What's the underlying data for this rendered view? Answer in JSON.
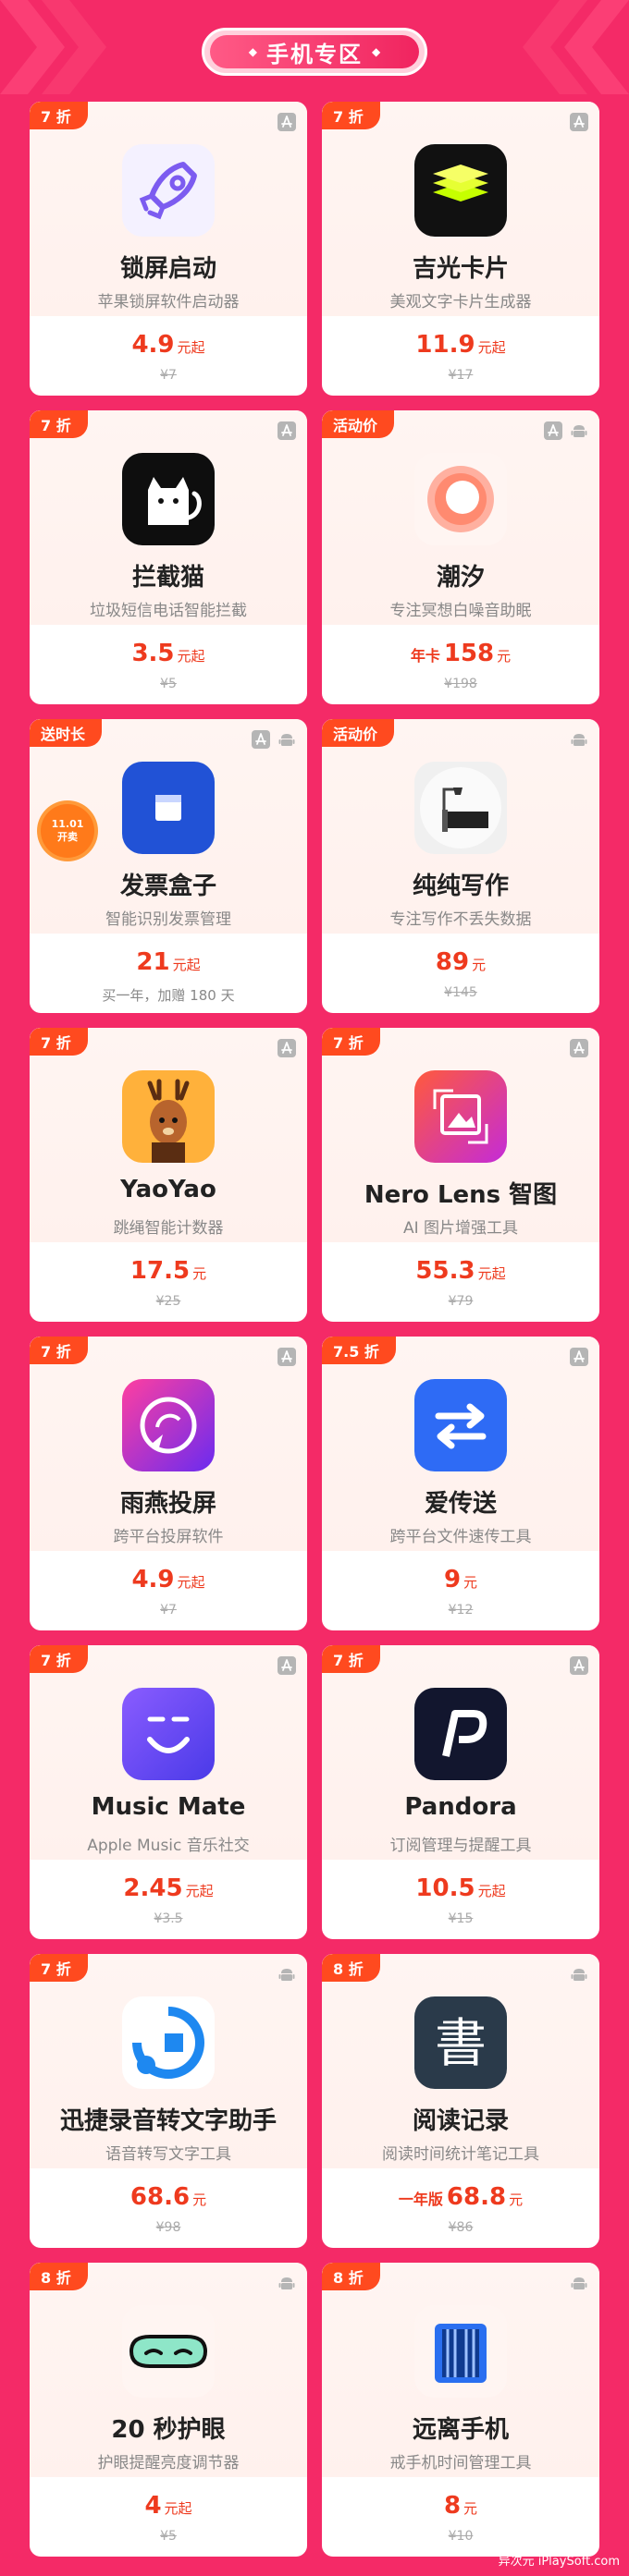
{
  "header": {
    "title": "手机专区",
    "deco_left": "◆",
    "deco_right": "◆"
  },
  "colors": {
    "background": "#f42a67",
    "badge": "#ff4a1f",
    "price": "#ee3a1e"
  },
  "cards": [
    {
      "badge": "7 折",
      "platforms": [
        "app-store"
      ],
      "icon": "rocket-icon",
      "name": "锁屏启动",
      "desc": "苹果锁屏软件启动器",
      "price_prefix": "",
      "price": "4.9",
      "unit": "元起",
      "original": "¥7"
    },
    {
      "badge": "7 折",
      "platforms": [
        "app-store"
      ],
      "icon": "layers-icon",
      "name": "吉光卡片",
      "desc": "美观文字卡片生成器",
      "price_prefix": "",
      "price": "11.9",
      "unit": "元起",
      "original": "¥17"
    },
    {
      "badge": "7 折",
      "platforms": [
        "app-store"
      ],
      "icon": "cat-icon",
      "name": "拦截猫",
      "desc": "垃圾短信电话智能拦截",
      "price_prefix": "",
      "price": "3.5",
      "unit": "元起",
      "original": "¥5"
    },
    {
      "badge": "活动价",
      "platforms": [
        "app-store",
        "android"
      ],
      "icon": "ring-icon",
      "name": "潮汐",
      "desc": "专注冥想白噪音助眠",
      "price_prefix": "年卡",
      "price": "158",
      "unit": "元",
      "original": "¥198"
    },
    {
      "badge": "送时长",
      "platforms": [
        "app-store",
        "android"
      ],
      "icon": "box-icon",
      "name": "发票盒子",
      "desc": "智能识别发票管理",
      "price_prefix": "",
      "price": "21",
      "unit": "元起",
      "note": "买一年，加赠 180 天",
      "seal": {
        "line1": "11.01",
        "line2": "开卖"
      }
    },
    {
      "badge": "活动价",
      "platforms": [
        "android"
      ],
      "icon": "desk-lamp-icon",
      "name": "纯纯写作",
      "desc": "专注写作不丢失数据",
      "price_prefix": "",
      "price": "89",
      "unit": "元",
      "original": "¥145"
    },
    {
      "badge": "7 折",
      "platforms": [
        "app-store"
      ],
      "icon": "deer-icon",
      "name": "YaoYao",
      "desc": "跳绳智能计数器",
      "price_prefix": "",
      "price": "17.5",
      "unit": "元",
      "original": "¥25"
    },
    {
      "badge": "7 折",
      "platforms": [
        "app-store"
      ],
      "icon": "picture-icon",
      "name": "Nero Lens 智图",
      "desc": "AI 图片增强工具",
      "price_prefix": "",
      "price": "55.3",
      "unit": "元起",
      "original": "¥79"
    },
    {
      "badge": "7 折",
      "platforms": [
        "app-store"
      ],
      "icon": "cast-icon",
      "name": "雨燕投屏",
      "desc": "跨平台投屏软件",
      "price_prefix": "",
      "price": "4.9",
      "unit": "元起",
      "original": "¥7"
    },
    {
      "badge": "7.5 折",
      "platforms": [
        "app-store"
      ],
      "icon": "transfer-arrows-icon",
      "name": "爱传送",
      "desc": "跨平台文件速传工具",
      "price_prefix": "",
      "price": "9",
      "unit": "元",
      "original": "¥12"
    },
    {
      "badge": "7 折",
      "platforms": [
        "app-store"
      ],
      "icon": "music-face-icon",
      "name": "Music Mate",
      "desc": "Apple Music 音乐社交",
      "price_prefix": "",
      "price": "2.45",
      "unit": "元起",
      "original": "¥3.5"
    },
    {
      "badge": "7 折",
      "platforms": [
        "app-store"
      ],
      "icon": "pandora-icon",
      "name": "Pandora",
      "desc": "订阅管理与提醒工具",
      "price_prefix": "",
      "price": "10.5",
      "unit": "元起",
      "original": "¥15"
    },
    {
      "badge": "7 折",
      "platforms": [
        "android"
      ],
      "icon": "voice-circle-icon",
      "name": "迅捷录音转文字助手",
      "desc": "语音转写文字工具",
      "price_prefix": "",
      "price": "68.6",
      "unit": "元",
      "original": "¥98"
    },
    {
      "badge": "8 折",
      "platforms": [
        "android"
      ],
      "icon": "book-char-icon",
      "name": "阅读记录",
      "desc": "阅读时间统计笔记工具",
      "price_prefix": "一年版",
      "price": "68.8",
      "unit": "元",
      "original": "¥86",
      "book_char": "書"
    },
    {
      "badge": "8 折",
      "platforms": [
        "android"
      ],
      "icon": "eye-mask-icon",
      "name": "20 秒护眼",
      "desc": "护眼提醒亮度调节器",
      "price_prefix": "",
      "price": "4",
      "unit": "元起",
      "original": "¥5"
    },
    {
      "badge": "8 折",
      "platforms": [
        "android"
      ],
      "icon": "phone-cage-icon",
      "name": "远离手机",
      "desc": "戒手机时间管理工具",
      "price_prefix": "",
      "price": "8",
      "unit": "元",
      "original": "¥10"
    }
  ],
  "footer": {
    "text": "异次元 iPlaySoft.com"
  }
}
